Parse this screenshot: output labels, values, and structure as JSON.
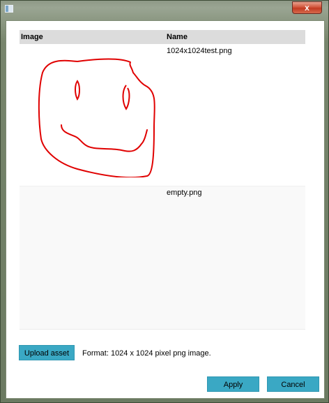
{
  "window": {
    "close_glyph": "x"
  },
  "table": {
    "headers": {
      "image": "Image",
      "name": "Name"
    },
    "rows": [
      {
        "name": "1024x1024test.png",
        "thumbnail": "red-smiley-drawing"
      },
      {
        "name": "empty.png",
        "thumbnail": "empty"
      }
    ]
  },
  "footer": {
    "upload_label": "Upload asset",
    "format_text": "Format: 1024 x 1024 pixel png image.",
    "apply_label": "Apply",
    "cancel_label": "Cancel"
  },
  "colors": {
    "button": "#3aa8c4",
    "header_bg": "#dcdcdc",
    "drawing": "#e00000"
  }
}
